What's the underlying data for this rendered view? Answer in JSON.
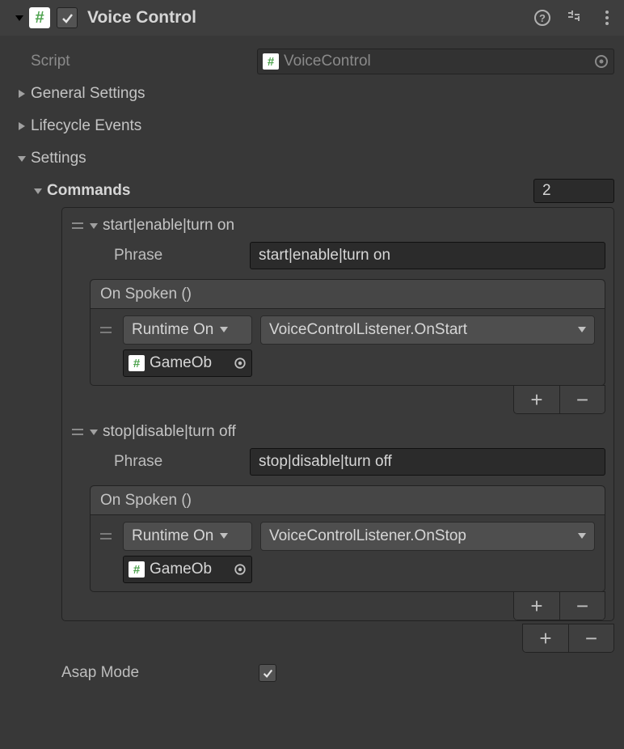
{
  "header": {
    "title": "Voice Control",
    "enabled": true
  },
  "script": {
    "label": "Script",
    "value": "VoiceControl"
  },
  "foldouts": {
    "general": {
      "label": "General Settings",
      "expanded": false
    },
    "lifecycle": {
      "label": "Lifecycle Events",
      "expanded": false
    },
    "settings": {
      "label": "Settings",
      "expanded": true
    }
  },
  "commands": {
    "label": "Commands",
    "count": "2",
    "phrase_label": "Phrase",
    "items": [
      {
        "title": "start|enable|turn on",
        "phrase": "start|enable|turn on",
        "event_label": "On Spoken ()",
        "callstate": "Runtime On",
        "function": "VoiceControlListener.OnStart",
        "target": "GameOb"
      },
      {
        "title": "stop|disable|turn off",
        "phrase": "stop|disable|turn off",
        "event_label": "On Spoken ()",
        "callstate": "Runtime On",
        "function": "VoiceControlListener.OnStop",
        "target": "GameOb"
      }
    ]
  },
  "asap": {
    "label": "Asap Mode",
    "value": true
  }
}
